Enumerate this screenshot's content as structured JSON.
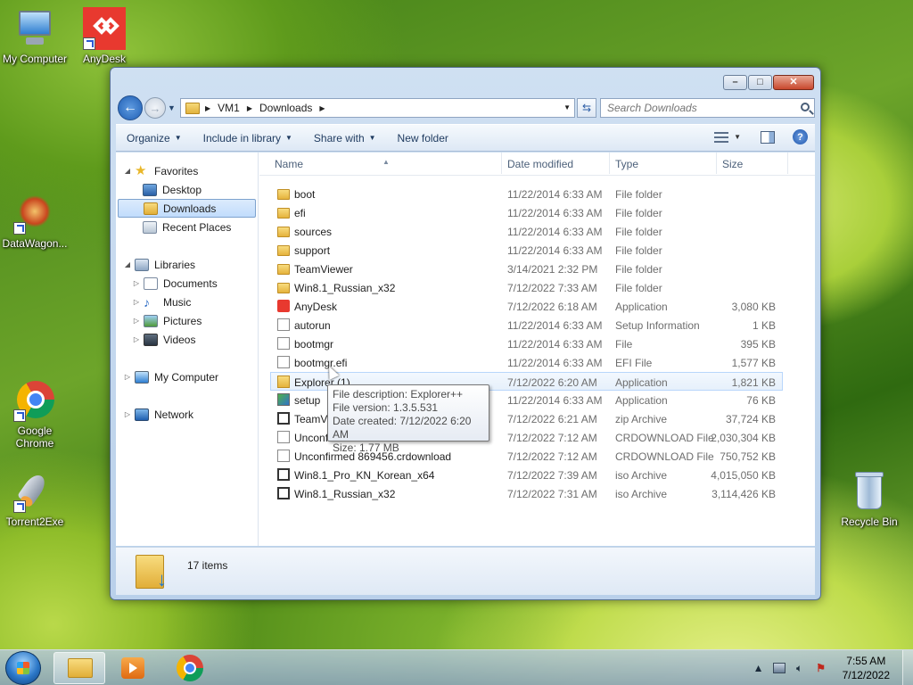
{
  "desktop": {
    "icons": {
      "my_computer": "My Computer",
      "anydesk": "AnyDesk",
      "datawagon": "DataWagon...",
      "chrome_line1": "Google",
      "chrome_line2": "Chrome",
      "torrent2exe": "Torrent2Exe",
      "recycle_bin": "Recycle Bin"
    }
  },
  "window": {
    "breadcrumb": [
      "VM1",
      "Downloads"
    ],
    "search_placeholder": "Search Downloads",
    "toolbar": {
      "organize": "Organize",
      "include_in_library": "Include in library",
      "share_with": "Share with",
      "new_folder": "New folder"
    },
    "nav": {
      "favorites": "Favorites",
      "desktop": "Desktop",
      "downloads": "Downloads",
      "recent_places": "Recent Places",
      "libraries": "Libraries",
      "documents": "Documents",
      "music": "Music",
      "pictures": "Pictures",
      "videos": "Videos",
      "my_computer": "My Computer",
      "network": "Network"
    },
    "columns": {
      "name": "Name",
      "date_modified": "Date modified",
      "type": "Type",
      "size": "Size"
    },
    "files": [
      {
        "name": "boot",
        "date": "11/22/2014 6:33 AM",
        "type": "File folder",
        "size": "",
        "icon": "folder-icon"
      },
      {
        "name": "efi",
        "date": "11/22/2014 6:33 AM",
        "type": "File folder",
        "size": "",
        "icon": "folder-icon"
      },
      {
        "name": "sources",
        "date": "11/22/2014 6:33 AM",
        "type": "File folder",
        "size": "",
        "icon": "folder-icon"
      },
      {
        "name": "support",
        "date": "11/22/2014 6:33 AM",
        "type": "File folder",
        "size": "",
        "icon": "folder-icon"
      },
      {
        "name": "TeamViewer",
        "date": "3/14/2021 2:32 PM",
        "type": "File folder",
        "size": "",
        "icon": "folder-icon"
      },
      {
        "name": "Win8.1_Russian_x32",
        "date": "7/12/2022 7:33 AM",
        "type": "File folder",
        "size": "",
        "icon": "folder-icon"
      },
      {
        "name": "AnyDesk",
        "date": "7/12/2022 6:18 AM",
        "type": "Application",
        "size": "3,080 KB",
        "icon": "anydesk-icon"
      },
      {
        "name": "autorun",
        "date": "11/22/2014 6:33 AM",
        "type": "Setup Information",
        "size": "1 KB",
        "icon": "settings-file-icon"
      },
      {
        "name": "bootmgr",
        "date": "11/22/2014 6:33 AM",
        "type": "File",
        "size": "395 KB",
        "icon": "file-icon"
      },
      {
        "name": "bootmgr.efi",
        "date": "11/22/2014 6:33 AM",
        "type": "EFI File",
        "size": "1,577 KB",
        "icon": "file-icon"
      },
      {
        "name": "Explorer (1)",
        "date": "7/12/2022 6:20 AM",
        "type": "Application",
        "size": "1,821 KB",
        "icon": "explorer-app-icon"
      },
      {
        "name": "setup",
        "date": "11/22/2014 6:33 AM",
        "type": "Application",
        "size": "76 KB",
        "icon": "setup-icon"
      },
      {
        "name": "TeamV",
        "date": "7/12/2022 6:21 AM",
        "type": "zip Archive",
        "size": "37,724 KB",
        "icon": "zip-icon"
      },
      {
        "name": "Unconf",
        "date": "7/12/2022 7:12 AM",
        "type": "CRDOWNLOAD File",
        "size": "2,030,304 KB",
        "icon": "file-icon"
      },
      {
        "name": "Unconfirmed 869456.crdownload",
        "date": "7/12/2022 7:12 AM",
        "type": "CRDOWNLOAD File",
        "size": "750,752 KB",
        "icon": "file-icon"
      },
      {
        "name": "Win8.1_Pro_KN_Korean_x64",
        "date": "7/12/2022 7:39 AM",
        "type": "iso Archive",
        "size": "4,015,050 KB",
        "icon": "iso-icon"
      },
      {
        "name": "Win8.1_Russian_x32",
        "date": "7/12/2022 7:31 AM",
        "type": "iso Archive",
        "size": "3,114,426 KB",
        "icon": "iso-icon"
      }
    ],
    "tooltip": {
      "description": "File description: Explorer++",
      "version": "File version: 1.3.5.531",
      "created": "Date created: 7/12/2022 6:20 AM",
      "size": "Size: 1.77 MB"
    },
    "status": {
      "item_count": "17 items"
    }
  },
  "taskbar": {
    "time": "7:55 AM",
    "date": "7/12/2022"
  }
}
